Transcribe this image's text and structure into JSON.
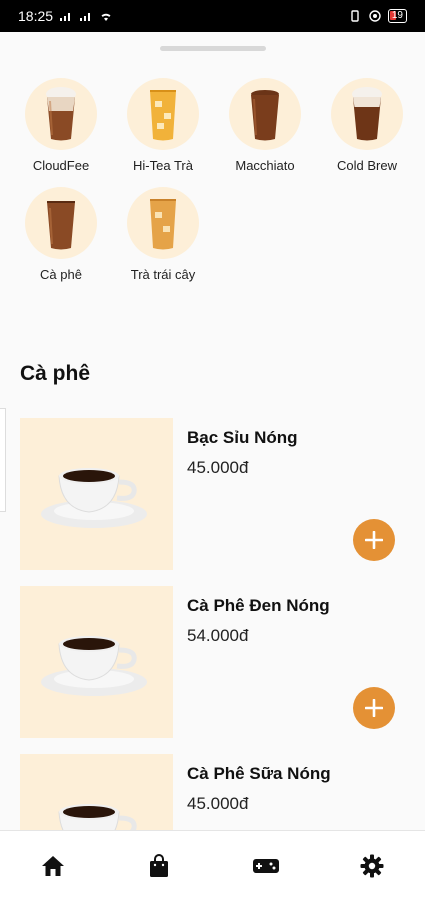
{
  "status_bar": {
    "time": "18:25",
    "battery": "19"
  },
  "categories": [
    {
      "label": "CloudFee",
      "icon": "iced-coffee-icon"
    },
    {
      "label": "Hi-Tea Trà",
      "icon": "iced-tea-icon"
    },
    {
      "label": "Macchiato",
      "icon": "macchiato-icon"
    },
    {
      "label": "Cold Brew",
      "icon": "cold-brew-icon"
    },
    {
      "label": "Cà phê",
      "icon": "coffee-glass-icon"
    },
    {
      "label": "Trà trái cây",
      "icon": "fruit-tea-icon"
    }
  ],
  "section": {
    "title": "Cà phê"
  },
  "products": [
    {
      "name": "Bạc Sỉu Nóng",
      "price": "45.000đ"
    },
    {
      "name": "Cà Phê Đen Nóng",
      "price": "54.000đ"
    },
    {
      "name": "Cà Phê Sữa Nóng",
      "price": "45.000đ"
    }
  ],
  "colors": {
    "accent": "#e49135",
    "category_bg": "#fdefd8"
  },
  "bottom_nav": [
    {
      "icon": "home-icon"
    },
    {
      "icon": "shopping-bag-icon"
    },
    {
      "icon": "gamepad-icon"
    },
    {
      "icon": "settings-icon"
    }
  ]
}
